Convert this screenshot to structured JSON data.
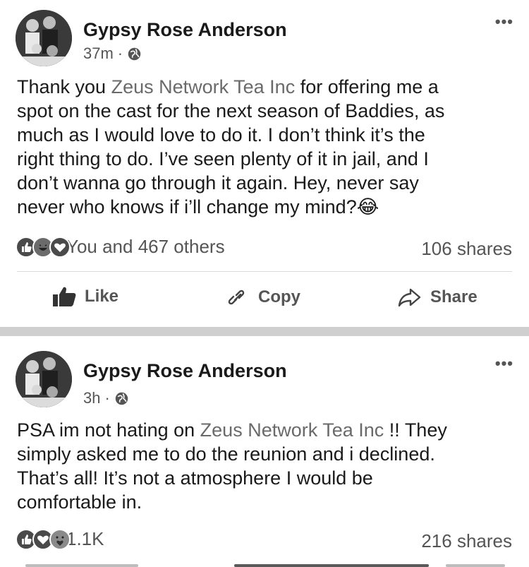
{
  "posts": [
    {
      "author": "Gypsy Rose Anderson",
      "time": "37m",
      "dot": "·",
      "text_before": "Thank you ",
      "mention": "Zeus Network Tea Inc",
      "text_after": " for offering me a\nspot on the cast for the next season of Baddies, as\nmuch as I would love to do it. I don’t think it’s the\nright thing to do. I’ve seen plenty of it in jail, and I\ndon’t wanna go through it again. Hey, never say\nnever who knows if i’ll change my mind?😂",
      "reactions_text": "You and 467 others",
      "shares": "106 shares",
      "actions": {
        "like": "Like",
        "copy": "Copy",
        "share": "Share"
      }
    },
    {
      "author": "Gypsy Rose Anderson",
      "time": "3h",
      "dot": "·",
      "text_before": "PSA im not hating on ",
      "mention": "Zeus Network Tea Inc",
      "text_after": " !! They\nsimply asked me to do the reunion and i declined.\nThat’s all! It’s not a atmosphere I would be\ncomfortable in.",
      "reactions_text": "1.1K",
      "shares": "216 shares"
    }
  ],
  "icons": {
    "more": "more-icon",
    "globe": "globe-icon",
    "like_reaction": "like-reaction-icon",
    "haha_reaction": "haha-reaction-icon",
    "love_reaction": "love-reaction-icon",
    "care_reaction": "care-reaction-icon",
    "thumb": "thumbs-up-icon",
    "link": "link-icon",
    "share": "share-arrow-icon"
  },
  "colors": {
    "link": "#6a6a6a",
    "separator": "#cfcfcf"
  }
}
